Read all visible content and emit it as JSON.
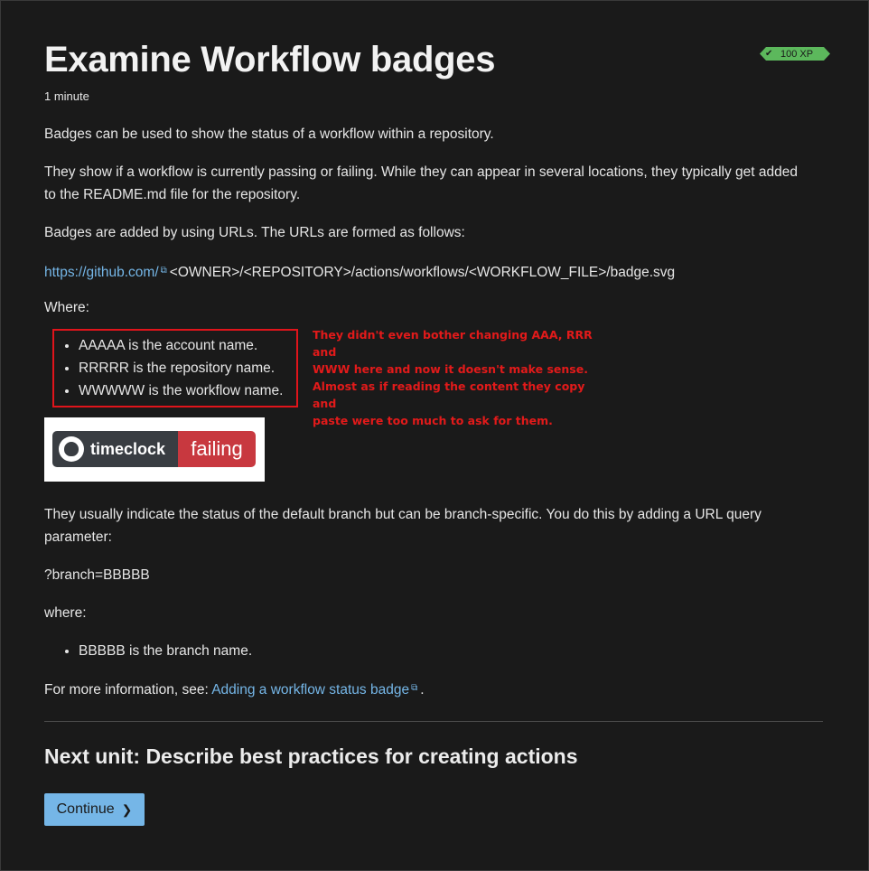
{
  "title": "Examine Workflow badges",
  "duration": "1 minute",
  "xp_badge": {
    "icon": "check-icon",
    "label": "100 XP",
    "color": "#5cb85c"
  },
  "paragraphs": {
    "intro": "Badges can be used to show the status of a workflow within a repository.",
    "show_line1": "They show if a workflow is currently passing or failing. While they can appear in several locations, they typically get added",
    "show_line2": "to the README.md file for the repository.",
    "urls": "Badges are added by using URLs. The URLs are formed as follows:",
    "where": "Where:",
    "usually_line1": "They usually indicate the status of the default branch but can be branch-specific. You do this by adding a URL query",
    "usually_line2": "parameter:",
    "branch_param": "?branch=BBBBB",
    "where_lower": "where:",
    "more_info_prefix": "For more information, see:",
    "more_info_suffix": "."
  },
  "url_line": {
    "link": "https://github.com/",
    "rest": "<OWNER>/<REPOSITORY>/actions/workflows/<WORKFLOW_FILE>/badge.svg"
  },
  "where_items": [
    "AAAAA is the account name.",
    "RRRRR is the repository name.",
    "WWWWW is the workflow name."
  ],
  "branch_items": [
    "BBBBB is the branch name."
  ],
  "annotation": {
    "line1": "They didn't even bother changing AAA, RRR and",
    "line2": "WWW here and now it doesn't make sense.",
    "line3": "Almost as if reading the content they copy and",
    "line4": "paste were too much to ask for them.",
    "color": "#e21a1a"
  },
  "status_badge": {
    "name": "timeclock",
    "status": "failing",
    "icon": "github-icon"
  },
  "more_info_link": "Adding a workflow status badge",
  "next_unit": "Next unit: Describe best practices for creating actions",
  "continue_label": "Continue",
  "accent": "#75b6e7"
}
